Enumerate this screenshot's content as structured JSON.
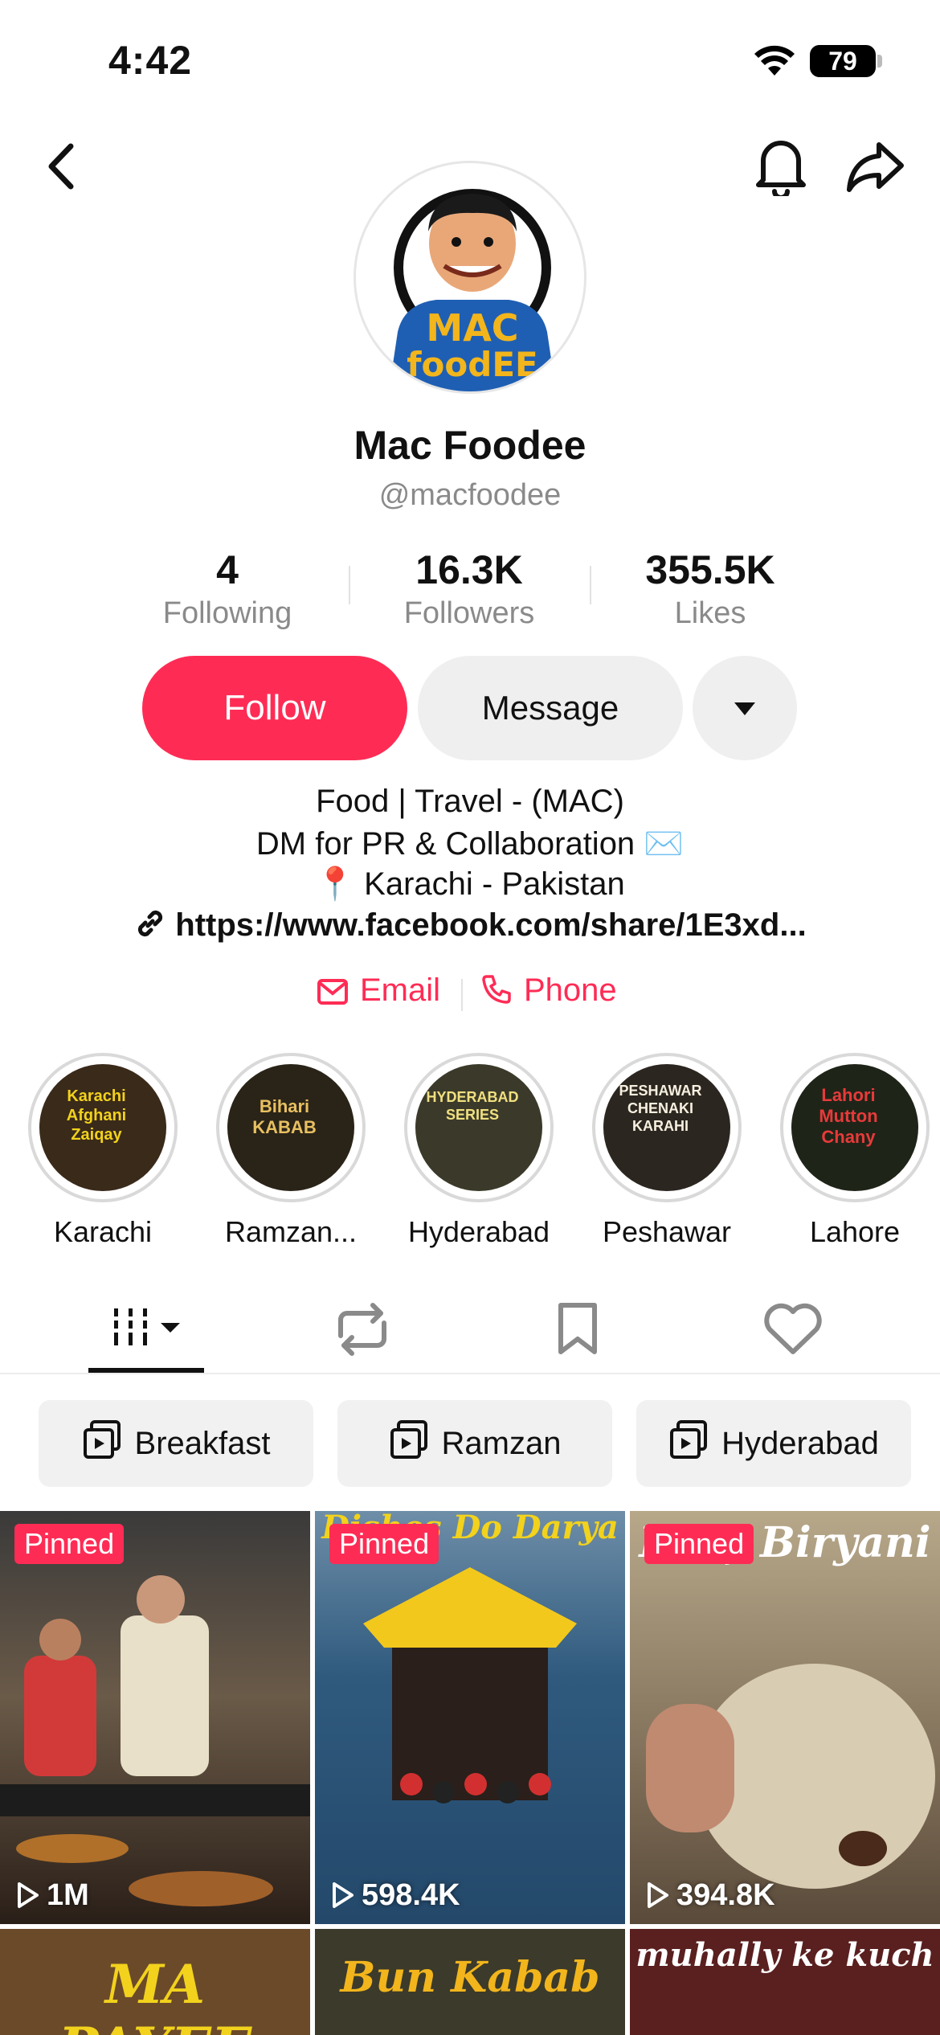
{
  "status_bar": {
    "time": "4:42",
    "battery": "79"
  },
  "profile": {
    "display_name": "Mac Foodee",
    "username": "@macfoodee",
    "avatar_text_1": "MAC",
    "avatar_text_2": "foodEE"
  },
  "stats": [
    {
      "value": "4",
      "label": "Following"
    },
    {
      "value": "16.3K",
      "label": "Followers"
    },
    {
      "value": "355.5K",
      "label": "Likes"
    }
  ],
  "actions": {
    "follow": "Follow",
    "message": "Message"
  },
  "bio": {
    "line1": "Food | Travel - (MAC)",
    "line2": "DM for PR & Collaboration ✉️",
    "line3": "📍 Karachi - Pakistan",
    "link": "https://www.facebook.com/share/1E3xd..."
  },
  "contact": {
    "email": "Email",
    "phone": "Phone"
  },
  "highlights": [
    {
      "label": "Karachi",
      "cover_text": "Karachi Afghani Zaiqay",
      "color": "#3a2a1a"
    },
    {
      "label": "Ramzan...",
      "cover_text": "Bihari KABAB",
      "color": "#2a2418"
    },
    {
      "label": "Hyderabad",
      "cover_text": "HYDERABAD SERIES",
      "color": "#3b3a2a"
    },
    {
      "label": "Peshawar",
      "cover_text": "PESHAWAR CHENAKI KARAHI",
      "color": "#2c2620"
    },
    {
      "label": "Lahore",
      "cover_text": "Lahori Mutton Chany",
      "color": "#1f2418"
    }
  ],
  "playlists": [
    "Breakfast",
    "Ramzan",
    "Hyderabad"
  ],
  "videos": [
    {
      "pinned": "Pinned",
      "views": "1M",
      "title": "",
      "bg": "#4b4036"
    },
    {
      "pinned": "Pinned",
      "views": "598.4K",
      "title": "Dishes Do Darya",
      "bg": "#3d6a8e"
    },
    {
      "pinned": "Pinned",
      "views": "394.8K",
      "title": "Beef Biryani",
      "bg": "#8a7a62"
    },
    {
      "pinned": "",
      "views": "",
      "title": "MA PAYEE",
      "bg": "#6b4a2a"
    },
    {
      "pinned": "",
      "views": "",
      "title": "Bun Kabab",
      "bg": "#3c3a2a"
    },
    {
      "pinned": "",
      "views": "",
      "title": "muhally ke kuch",
      "bg": "#5a1f1f"
    }
  ],
  "colors": {
    "accent": "#fe2c55",
    "muted": "#8a8a8a",
    "button_bg": "#efefef"
  }
}
